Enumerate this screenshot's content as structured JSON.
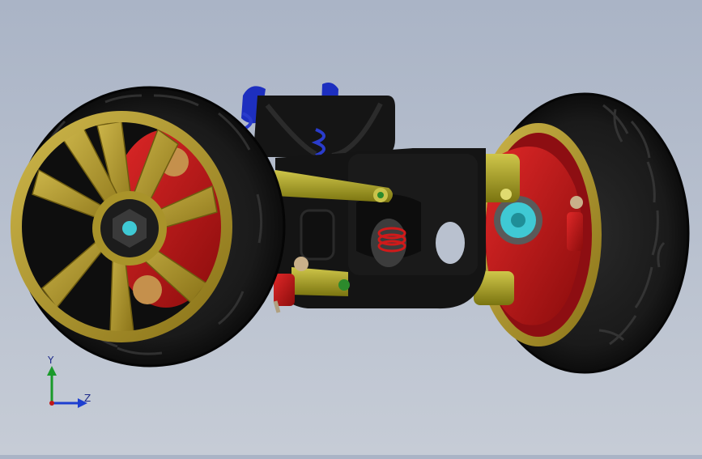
{
  "viewport": {
    "background_top": "#aab4c6",
    "background_bottom": "#c6ccd6"
  },
  "model": {
    "colors": {
      "tire": "#1c1c1c",
      "rim": "#b49a2a",
      "hub": "#c0141b",
      "chassis": "#121212",
      "arm": "#a8a020",
      "spring_blue": "#1d2fbf",
      "bearing": "#3fc9d4",
      "spring_red": "#d01a1a"
    }
  },
  "triad": {
    "y_label": "Y",
    "z_label": "Z",
    "colors": {
      "y": "#1a9a2a",
      "z": "#1d3fd0",
      "origin": "#c01818"
    }
  }
}
